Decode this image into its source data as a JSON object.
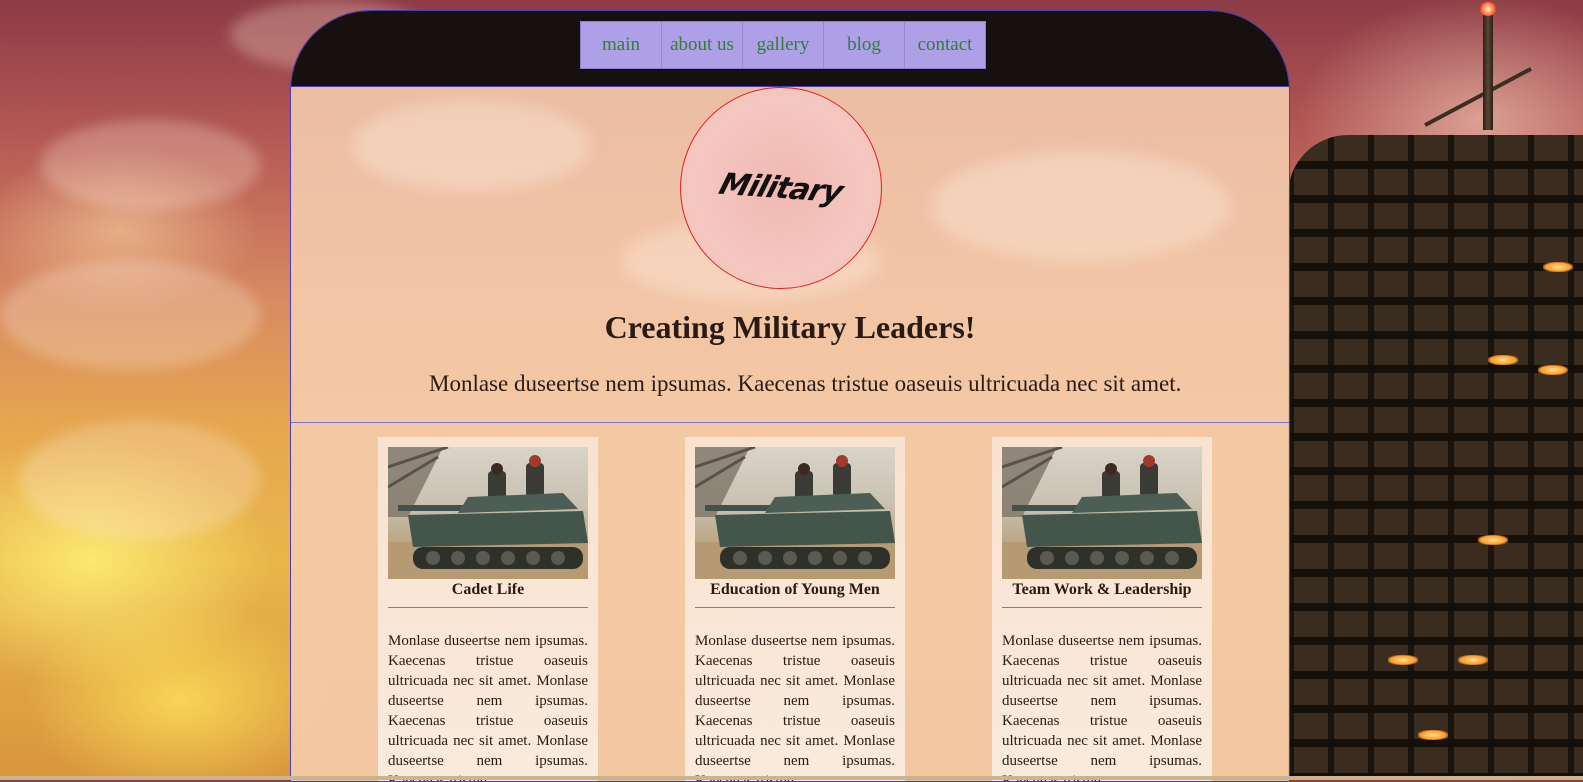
{
  "nav": {
    "items": [
      {
        "label": "main"
      },
      {
        "label": "about us"
      },
      {
        "label": "gallery"
      },
      {
        "label": "blog"
      },
      {
        "label": "contact"
      }
    ]
  },
  "logo": {
    "text": "Military"
  },
  "hero": {
    "headline": "Creating Military Leaders!",
    "intro": "Monlase duseertse nem ipsumas. Kaecenas tristue oaseuis ultricuada nec sit amet."
  },
  "cards": [
    {
      "image": "tank-photo",
      "title": "Cadet Life",
      "body": "Monlase duseertse nem ipsumas. Kaecenas tristue oaseuis ultricuada nec sit amet. Monlase duseertse nem ipsumas. Kaecenas tristue oaseuis ultricuada nec sit amet. Monlase duseertse nem ipsumas. Kaecenas tristue"
    },
    {
      "image": "tank-photo",
      "title": "Education of Young Men",
      "body": "Monlase duseertse nem ipsumas. Kaecenas tristue oaseuis ultricuada nec sit amet. Monlase duseertse nem ipsumas. Kaecenas tristue oaseuis ultricuada nec sit amet. Monlase duseertse nem ipsumas. Kaecenas tristue"
    },
    {
      "image": "tank-photo",
      "title": "Team Work & Leadership",
      "body": "Monlase duseertse nem ipsumas. Kaecenas tristue oaseuis ultricuada nec sit amet. Monlase duseertse nem ipsumas. Kaecenas tristue oaseuis ultricuada nec sit amet. Monlase duseertse nem ipsumas. Kaecenas tristue"
    }
  ],
  "colors": {
    "nav_bg": "#ada0e6",
    "nav_text": "#2f7f34",
    "header_bg": "#171011",
    "panel_border": "#4b3bbf",
    "logo_border": "#e02020"
  }
}
